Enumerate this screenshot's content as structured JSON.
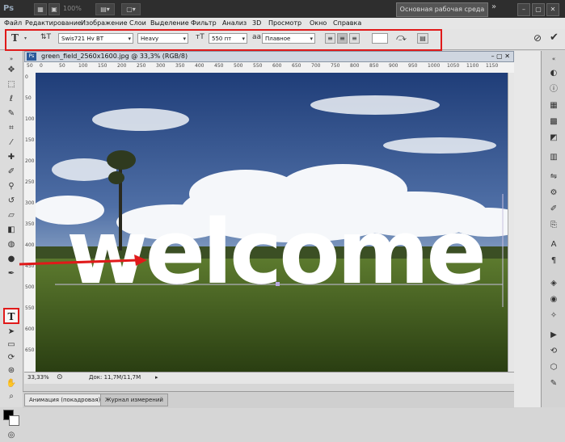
{
  "app": {
    "logo": "Ps",
    "zoom": "100%",
    "workspace": "Основная рабочая среда"
  },
  "menu": [
    "Файл",
    "Редактирование",
    "Изображение",
    "Слои",
    "Выделение",
    "Фильтр",
    "Анализ",
    "3D",
    "Просмотр",
    "Окно",
    "Справка"
  ],
  "options": {
    "font_family": "Swis721 Hv BT",
    "font_style": "Heavy",
    "font_size": "550 пт",
    "aa_label": "aa",
    "antialias": "Плавное"
  },
  "document": {
    "tab_title": "green_field_2560x1600.jpg @ 33,3% (RGB/8)",
    "canvas_text": "welcome",
    "ruler_top": [
      "50",
      "0",
      "50",
      "100",
      "150",
      "200",
      "250",
      "300",
      "350",
      "400",
      "450",
      "500",
      "550",
      "600",
      "650",
      "700",
      "750",
      "800",
      "850",
      "900",
      "950",
      "1000",
      "1050",
      "1100",
      "1150"
    ],
    "ruler_left": [
      "0",
      "50",
      "100",
      "150",
      "200",
      "250",
      "300",
      "350",
      "400",
      "450",
      "500",
      "550",
      "600",
      "650"
    ],
    "zoom": "33,33%",
    "doc_size": "Док: 11,7M/11,7M"
  },
  "bottom_tabs": [
    "Анимация (покадровая)",
    "Журнал измерений"
  ]
}
